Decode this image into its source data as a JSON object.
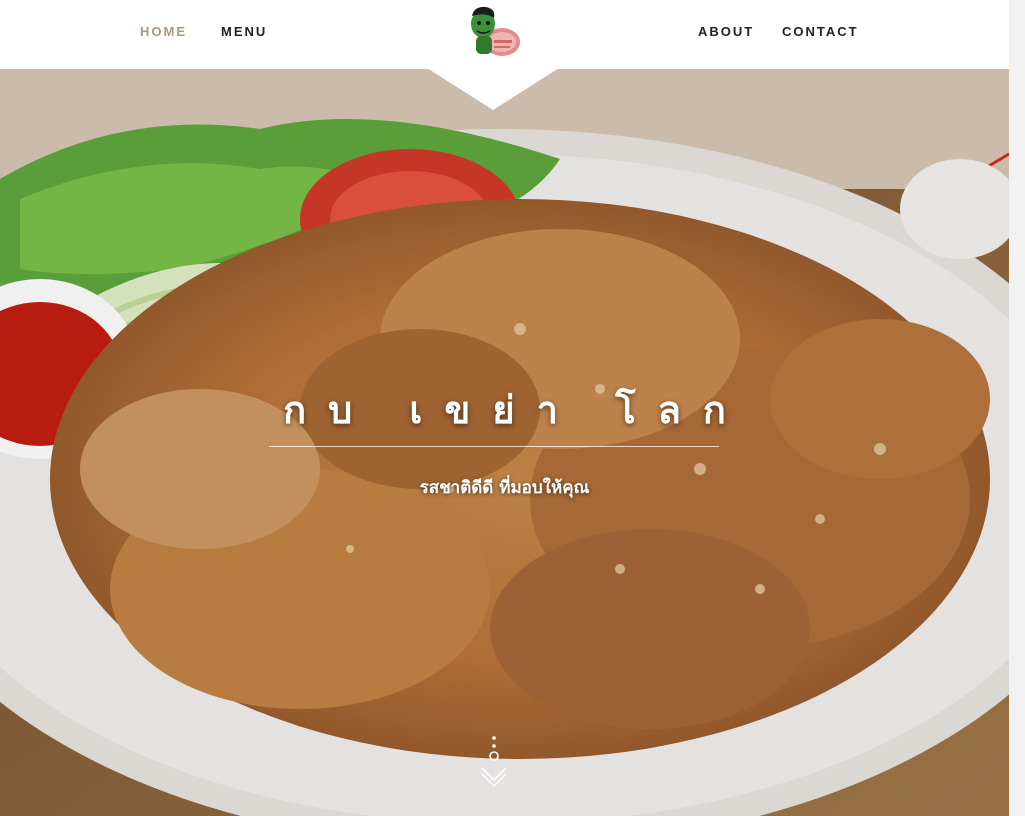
{
  "nav": {
    "home": "HOME",
    "menu": "MENU",
    "about": "ABOUT",
    "contact": "CONTACT"
  },
  "hero": {
    "title": "กบ เขย่า โลก",
    "subtitle": "รสชาติดีดี ที่มอบให้คุณ"
  },
  "colors": {
    "accent": "#a89a82",
    "nav_text": "#222222",
    "nav_bg": "#ffffff"
  },
  "icons": {
    "logo": "frog-mascot-logo",
    "scroll": "scroll-down-icon"
  }
}
